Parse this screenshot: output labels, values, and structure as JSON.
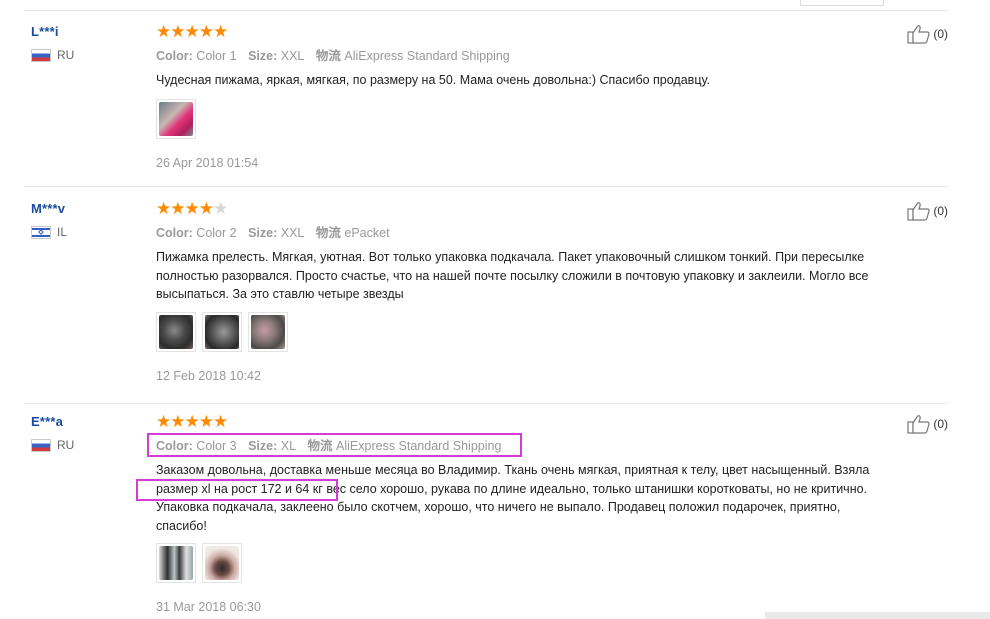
{
  "reviews": [
    {
      "user": "L***i",
      "country": "RU",
      "rating": 5,
      "color_label": "Color:",
      "color_value": "Color 1",
      "size_label": "Size:",
      "size_value": "XXL",
      "logistics_label": "物流",
      "logistics_value": "AliExpress Standard Shipping",
      "text": "Чудесная пижама, яркая, мягкая, по размеру на 50. Мама очень довольна:) Спасибо продавцу.",
      "photos": [
        "pink-pajama-photo"
      ],
      "date": "26 Apr 2018 01:54",
      "likes": "(0)"
    },
    {
      "user": "M***v",
      "country": "IL",
      "rating": 4,
      "color_label": "Color:",
      "color_value": "Color 2",
      "size_label": "Size:",
      "size_value": "XXL",
      "logistics_label": "物流",
      "logistics_value": "ePacket",
      "text": "Пижамка прелесть. Мягкая, уютная. Вот только упаковка подкачала. Пакет упаковочный слишком тонкий. При пересылке полностью разорвался. Просто счастье, что на нашей почте посылку сложили в почтовую упаковку и заклеили. Могло все высыпаться. За это ставлю четыре звезды",
      "photos": [
        "torn-package-photo-1",
        "torn-package-photo-2",
        "torn-package-photo-3"
      ],
      "date": "12 Feb 2018 10:42",
      "likes": "(0)"
    },
    {
      "user": "E***a",
      "country": "RU",
      "rating": 5,
      "color_label": "Color:",
      "color_value": "Color 3",
      "size_label": "Size:",
      "size_value": "XL",
      "logistics_label": "物流",
      "logistics_value": "AliExpress Standard Shipping",
      "text": "Заказом довольна, доставка меньше месяца во Владимир. Ткань очень мягкая, приятная к телу, цвет насыщенный. Взяла размер xl на рост 172 и 64 кг. Вес село хорошо, рукава по длине идеально, только штанишки коротковаты, но не критично. Упаковка подкачала, заклеено было скотчем, хорошо, что ничего не выпало. Продавец положил подарочек, приятно, спасибо!",
      "text_line1": "Заказом довольна, доставка меньше месяца во Владимир. Ткань очень мягкая, приятная к телу, цвет насыщенный. Взяла",
      "text_highlight": "размер xl на рост 172 и 64 кг",
      "text_line2_rest": "вес село хорошо, рукава по длине идеально, только штанишки коротковаты, но не критично.",
      "text_line3": "Упаковка подкачала, заклеено было скотчем, хорошо, что ничего не выпало. Продавец положил подарочек, приятно,",
      "text_line4": "спасибо!",
      "photos": [
        "pajama-worn-photo",
        "gift-hairband-photo"
      ],
      "date": "31 Mar 2018 06:30",
      "likes": "(0)"
    }
  ],
  "colors": {
    "star_on": "#ff8a00",
    "star_off": "#d7d7d7",
    "username": "#1a4b9f",
    "highlight_box": "#d63bd6"
  }
}
